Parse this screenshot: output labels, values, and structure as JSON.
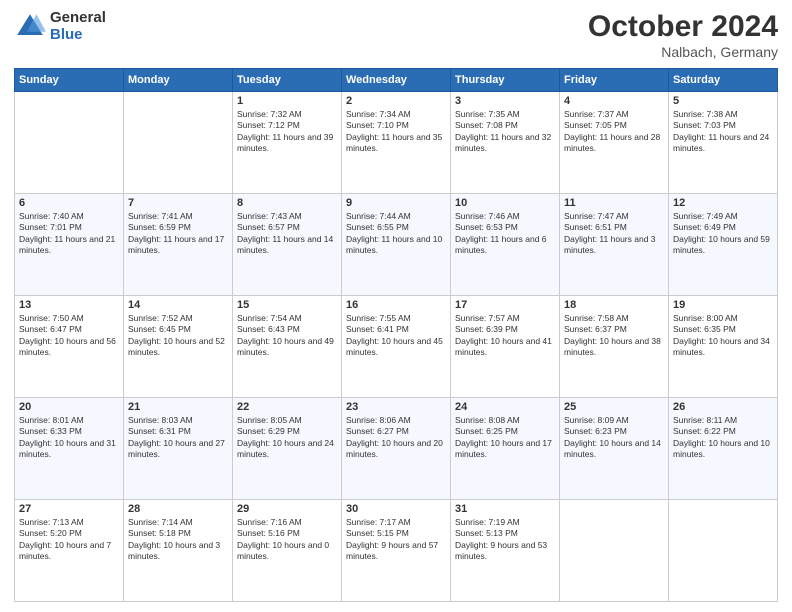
{
  "header": {
    "logo_general": "General",
    "logo_blue": "Blue",
    "month_title": "October 2024",
    "location": "Nalbach, Germany"
  },
  "weekdays": [
    "Sunday",
    "Monday",
    "Tuesday",
    "Wednesday",
    "Thursday",
    "Friday",
    "Saturday"
  ],
  "weeks": [
    [
      {
        "day": "",
        "info": ""
      },
      {
        "day": "",
        "info": ""
      },
      {
        "day": "1",
        "info": "Sunrise: 7:32 AM\nSunset: 7:12 PM\nDaylight: 11 hours and 39 minutes."
      },
      {
        "day": "2",
        "info": "Sunrise: 7:34 AM\nSunset: 7:10 PM\nDaylight: 11 hours and 35 minutes."
      },
      {
        "day": "3",
        "info": "Sunrise: 7:35 AM\nSunset: 7:08 PM\nDaylight: 11 hours and 32 minutes."
      },
      {
        "day": "4",
        "info": "Sunrise: 7:37 AM\nSunset: 7:05 PM\nDaylight: 11 hours and 28 minutes."
      },
      {
        "day": "5",
        "info": "Sunrise: 7:38 AM\nSunset: 7:03 PM\nDaylight: 11 hours and 24 minutes."
      }
    ],
    [
      {
        "day": "6",
        "info": "Sunrise: 7:40 AM\nSunset: 7:01 PM\nDaylight: 11 hours and 21 minutes."
      },
      {
        "day": "7",
        "info": "Sunrise: 7:41 AM\nSunset: 6:59 PM\nDaylight: 11 hours and 17 minutes."
      },
      {
        "day": "8",
        "info": "Sunrise: 7:43 AM\nSunset: 6:57 PM\nDaylight: 11 hours and 14 minutes."
      },
      {
        "day": "9",
        "info": "Sunrise: 7:44 AM\nSunset: 6:55 PM\nDaylight: 11 hours and 10 minutes."
      },
      {
        "day": "10",
        "info": "Sunrise: 7:46 AM\nSunset: 6:53 PM\nDaylight: 11 hours and 6 minutes."
      },
      {
        "day": "11",
        "info": "Sunrise: 7:47 AM\nSunset: 6:51 PM\nDaylight: 11 hours and 3 minutes."
      },
      {
        "day": "12",
        "info": "Sunrise: 7:49 AM\nSunset: 6:49 PM\nDaylight: 10 hours and 59 minutes."
      }
    ],
    [
      {
        "day": "13",
        "info": "Sunrise: 7:50 AM\nSunset: 6:47 PM\nDaylight: 10 hours and 56 minutes."
      },
      {
        "day": "14",
        "info": "Sunrise: 7:52 AM\nSunset: 6:45 PM\nDaylight: 10 hours and 52 minutes."
      },
      {
        "day": "15",
        "info": "Sunrise: 7:54 AM\nSunset: 6:43 PM\nDaylight: 10 hours and 49 minutes."
      },
      {
        "day": "16",
        "info": "Sunrise: 7:55 AM\nSunset: 6:41 PM\nDaylight: 10 hours and 45 minutes."
      },
      {
        "day": "17",
        "info": "Sunrise: 7:57 AM\nSunset: 6:39 PM\nDaylight: 10 hours and 41 minutes."
      },
      {
        "day": "18",
        "info": "Sunrise: 7:58 AM\nSunset: 6:37 PM\nDaylight: 10 hours and 38 minutes."
      },
      {
        "day": "19",
        "info": "Sunrise: 8:00 AM\nSunset: 6:35 PM\nDaylight: 10 hours and 34 minutes."
      }
    ],
    [
      {
        "day": "20",
        "info": "Sunrise: 8:01 AM\nSunset: 6:33 PM\nDaylight: 10 hours and 31 minutes."
      },
      {
        "day": "21",
        "info": "Sunrise: 8:03 AM\nSunset: 6:31 PM\nDaylight: 10 hours and 27 minutes."
      },
      {
        "day": "22",
        "info": "Sunrise: 8:05 AM\nSunset: 6:29 PM\nDaylight: 10 hours and 24 minutes."
      },
      {
        "day": "23",
        "info": "Sunrise: 8:06 AM\nSunset: 6:27 PM\nDaylight: 10 hours and 20 minutes."
      },
      {
        "day": "24",
        "info": "Sunrise: 8:08 AM\nSunset: 6:25 PM\nDaylight: 10 hours and 17 minutes."
      },
      {
        "day": "25",
        "info": "Sunrise: 8:09 AM\nSunset: 6:23 PM\nDaylight: 10 hours and 14 minutes."
      },
      {
        "day": "26",
        "info": "Sunrise: 8:11 AM\nSunset: 6:22 PM\nDaylight: 10 hours and 10 minutes."
      }
    ],
    [
      {
        "day": "27",
        "info": "Sunrise: 7:13 AM\nSunset: 5:20 PM\nDaylight: 10 hours and 7 minutes."
      },
      {
        "day": "28",
        "info": "Sunrise: 7:14 AM\nSunset: 5:18 PM\nDaylight: 10 hours and 3 minutes."
      },
      {
        "day": "29",
        "info": "Sunrise: 7:16 AM\nSunset: 5:16 PM\nDaylight: 10 hours and 0 minutes."
      },
      {
        "day": "30",
        "info": "Sunrise: 7:17 AM\nSunset: 5:15 PM\nDaylight: 9 hours and 57 minutes."
      },
      {
        "day": "31",
        "info": "Sunrise: 7:19 AM\nSunset: 5:13 PM\nDaylight: 9 hours and 53 minutes."
      },
      {
        "day": "",
        "info": ""
      },
      {
        "day": "",
        "info": ""
      }
    ]
  ]
}
